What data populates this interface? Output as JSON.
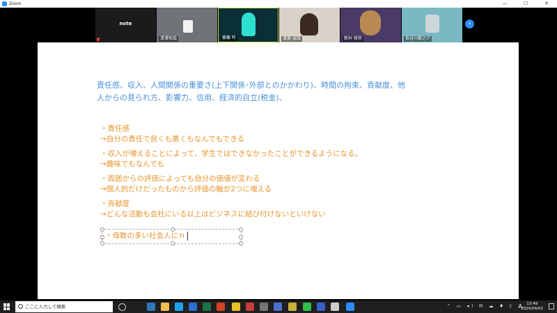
{
  "window": {
    "title": "Zoom",
    "minimize": "—",
    "maximize": "☐",
    "close": "✕"
  },
  "participants": [
    {
      "name": "",
      "label": "note",
      "bg": "#1b1b1b"
    },
    {
      "name": "清澤拓哉",
      "bg": "#6f7378"
    },
    {
      "name": "齋藤 咋",
      "bg": "#0b2f36"
    },
    {
      "name": "渡邉 瑞哉",
      "bg": "#d8d2c8"
    },
    {
      "name": "新村 修弥",
      "bg": "#4a3a66"
    },
    {
      "name": "長谷川龍之介",
      "bg": "#7ab8c4"
    }
  ],
  "slide": {
    "summary": "責任感、収入、人間関係の重要さ(上下関係･外部とのかかわり)、時間の拘束、貢献度、他人からの見られ方、影響力、信用、経済的自立(税金)、",
    "items": [
      {
        "line1": "・責任感",
        "line2": "→自分の責任で良くも悪くもなんでもできる"
      },
      {
        "line1": "・収入が増えることによって、学生ではできなかったことができるようになる。",
        "line2": "→趣味でもなんでも"
      },
      {
        "line1": "・周囲からの評価によっても自分の価値が変わる",
        "line2": "→個人的だけだったものから評価の軸が2つに増える"
      },
      {
        "line1": "・貢献度",
        "line2": "→どんな活動も会社にいる以上はビジネスに結び付けないといけない"
      }
    ],
    "editing_text": "・母数の多い社会人にｎ"
  },
  "taskbar": {
    "search_placeholder": "ここに入力して検索",
    "time": "13:49",
    "date": "2020/04/02",
    "ime": "A",
    "apps": [
      {
        "name": "task-view-icon",
        "color": "#888"
      },
      {
        "name": "edge-icon",
        "color": "#3277bc"
      },
      {
        "name": "explorer-icon",
        "color": "#f2c14e"
      },
      {
        "name": "ie-icon",
        "color": "#1ea0e8"
      },
      {
        "name": "mail-icon",
        "color": "#2b6fd0"
      },
      {
        "name": "excel-icon",
        "color": "#1f7244"
      },
      {
        "name": "powerpoint-icon",
        "color": "#d04423"
      },
      {
        "name": "chrome-icon",
        "color": "#e8c22e"
      },
      {
        "name": "photo-icon",
        "color": "#c73c3c"
      },
      {
        "name": "app-icon",
        "color": "#777"
      },
      {
        "name": "store-icon",
        "color": "#4a6fd0"
      },
      {
        "name": "sticky-icon",
        "color": "#c8b23a"
      },
      {
        "name": "line-icon",
        "color": "#2fbf4a"
      },
      {
        "name": "app2-icon",
        "color": "#3a5fc8"
      },
      {
        "name": "app3-icon",
        "color": "#ccc"
      },
      {
        "name": "zoom-icon",
        "color": "#2d8cff"
      }
    ]
  }
}
